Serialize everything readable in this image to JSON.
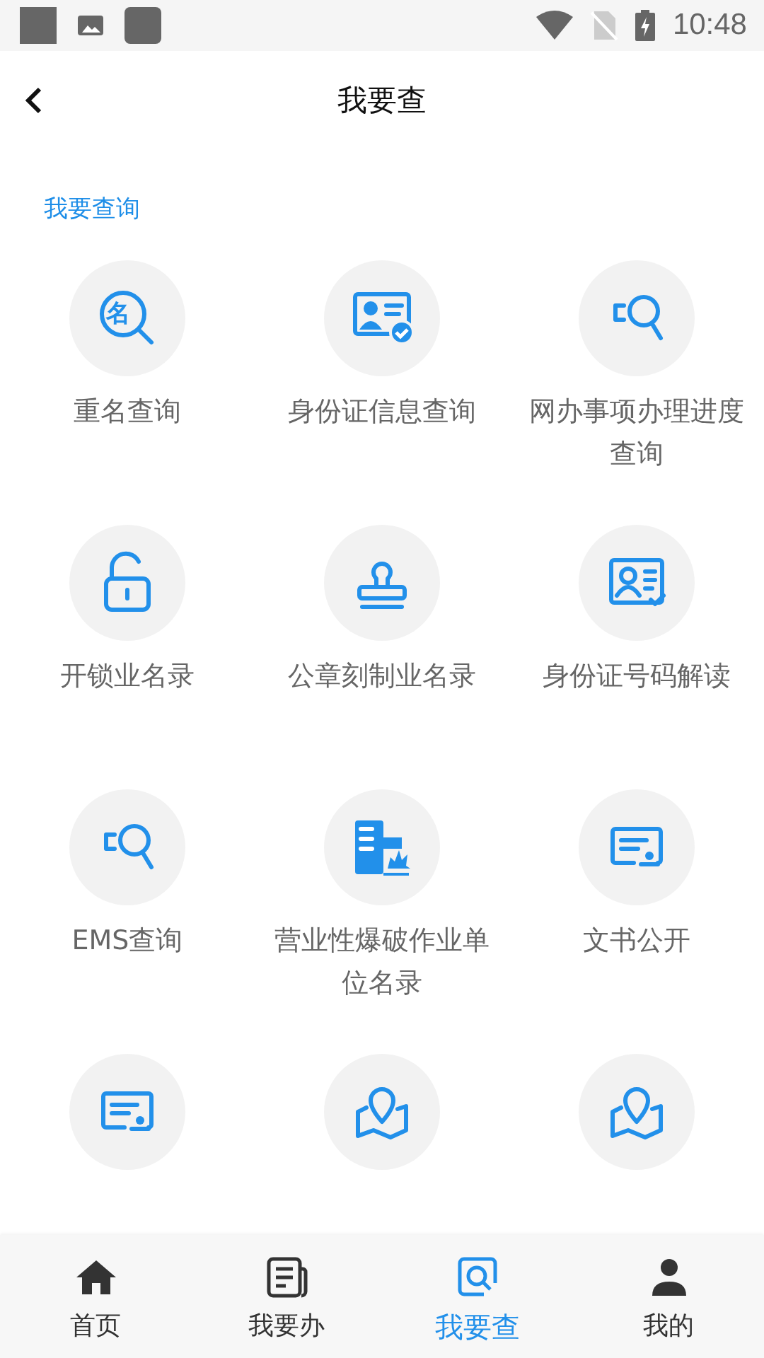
{
  "status_bar": {
    "time": "10:48"
  },
  "header": {
    "title": "我要查"
  },
  "section": {
    "title": "我要查询"
  },
  "items": [
    {
      "kind": "name",
      "icon_text": "名",
      "label": "重名查询"
    },
    {
      "kind": "idcheck",
      "label": "身份证信息查询"
    },
    {
      "kind": "progress",
      "label": "网办事项办理进度查询"
    },
    {
      "kind": "unlock",
      "label": "开锁业名录"
    },
    {
      "kind": "stamp",
      "label": "公章刻制业名录"
    },
    {
      "kind": "idcard",
      "label": "身份证号码解读"
    },
    {
      "kind": "progress",
      "label": "EMS查询"
    },
    {
      "kind": "blast",
      "label": "营业性爆破作业单位名录"
    },
    {
      "kind": "document",
      "label": "文书公开"
    },
    {
      "kind": "document"
    },
    {
      "kind": "map"
    },
    {
      "kind": "map"
    }
  ],
  "tabs": [
    {
      "kind": "home",
      "label": "首页",
      "selected": false
    },
    {
      "kind": "news",
      "label": "我要办",
      "selected": false
    },
    {
      "kind": "search",
      "label": "我要查",
      "selected": true
    },
    {
      "kind": "person",
      "label": "我的",
      "selected": false
    }
  ]
}
